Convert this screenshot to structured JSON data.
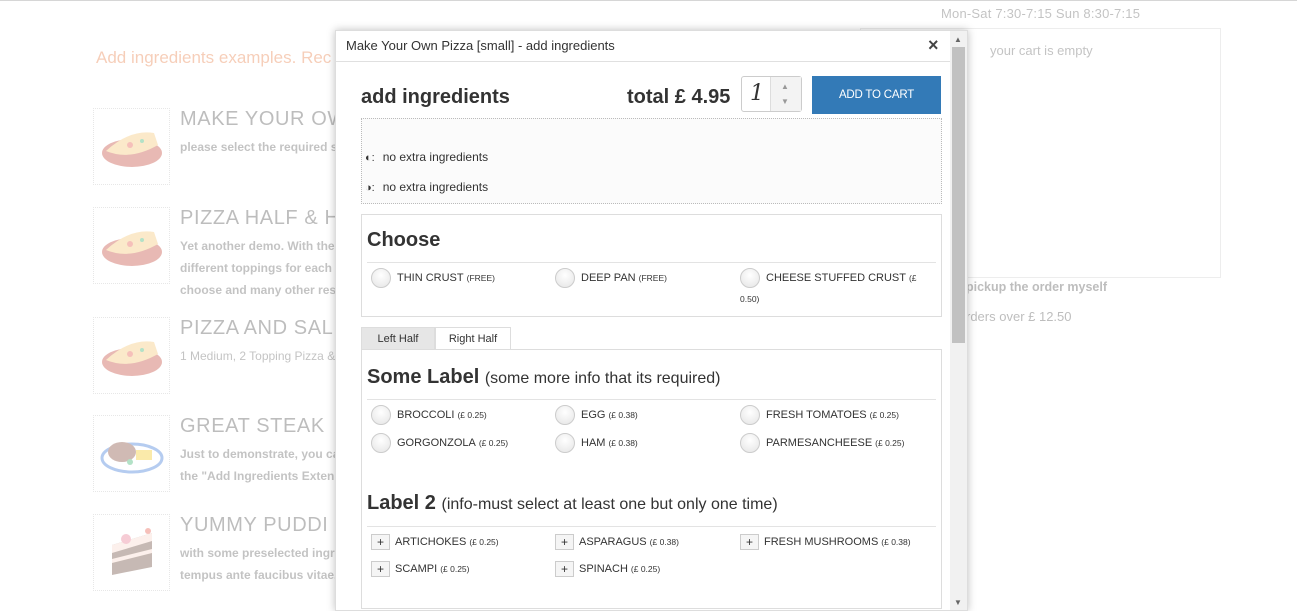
{
  "page": {
    "hours": "Mon-Sat  7:30-7:15  Sun  8:30-7:15",
    "heading": "Add ingredients examples. Rec",
    "menu_items": [
      {
        "title": "MAKE YOUR OW",
        "desc": [
          "please select the required s"
        ],
        "image": "pizza-image"
      },
      {
        "title": "PIZZA HALF & H",
        "desc": [
          "Yet another demo. With the",
          "different toppings for each",
          "choose and many other rest"
        ],
        "image": "pizza-image"
      },
      {
        "title": "PIZZA AND SAL",
        "desc": [
          "1 Medium, 2 Topping Pizza &"
        ],
        "image": "pizza-image"
      },
      {
        "title": "GREAT STEAK",
        "desc": [
          "Just to demonstrate, you ca",
          "the \"Add Ingredients Exten"
        ],
        "image": "steak-image"
      },
      {
        "title": "YUMMY PUDDI",
        "desc": [
          "with some preselected ingr",
          "tempus ante faucibus vitae."
        ],
        "image": "cake-image"
      }
    ],
    "cart": {
      "empty_text": "your cart is empty",
      "pickup_text": "pickup the order myself",
      "orders_over_text": "rders over £ 12.50"
    }
  },
  "modal": {
    "title": "Make Your Own Pizza [small] - add ingredients",
    "close_icon": "×",
    "heading": "add ingredients",
    "total": "total £ 4.95",
    "quantity": "1",
    "add_to_cart": "ADD TO CART",
    "summary": [
      {
        "icon": "◐:",
        "text": "no extra ingredients"
      },
      {
        "icon": "◑:",
        "text": "no extra ingredients"
      }
    ],
    "choose": {
      "title": "Choose",
      "options": [
        {
          "label": "THIN CRUST",
          "price": "(FREE)"
        },
        {
          "label": "DEEP PAN",
          "price": "(FREE)"
        },
        {
          "label": "CHEESE STUFFED CRUST",
          "price": "(£",
          "price_wrap": "0.50)"
        }
      ]
    },
    "tabs": [
      "Left Half",
      "Right Half"
    ],
    "some_label": {
      "title": "Some Label",
      "subtitle": "(some more info that its required)",
      "options": [
        {
          "label": "BROCCOLI",
          "price": "(£ 0.25)"
        },
        {
          "label": "EGG",
          "price": "(£ 0.38)"
        },
        {
          "label": "FRESH TOMATOES",
          "price": "(£ 0.25)"
        },
        {
          "label": "GORGONZOLA",
          "price": "(£ 0.25)"
        },
        {
          "label": "HAM",
          "price": "(£ 0.38)"
        },
        {
          "label": "PARMESANCHEESE",
          "price": "(£ 0.25)"
        }
      ]
    },
    "label2": {
      "title": "Label 2",
      "subtitle": "(info-must select at least one but only one time)",
      "plus": "+",
      "options": [
        {
          "label": "ARTICHOKES",
          "price": "(£ 0.25)"
        },
        {
          "label": "ASPARAGUS",
          "price": "(£ 0.38)"
        },
        {
          "label": "FRESH MUSHROOMS",
          "price": "(£ 0.38)"
        },
        {
          "label": "SCAMPI",
          "price": "(£ 0.25)"
        },
        {
          "label": "SPINACH",
          "price": "(£ 0.25)"
        }
      ]
    }
  }
}
